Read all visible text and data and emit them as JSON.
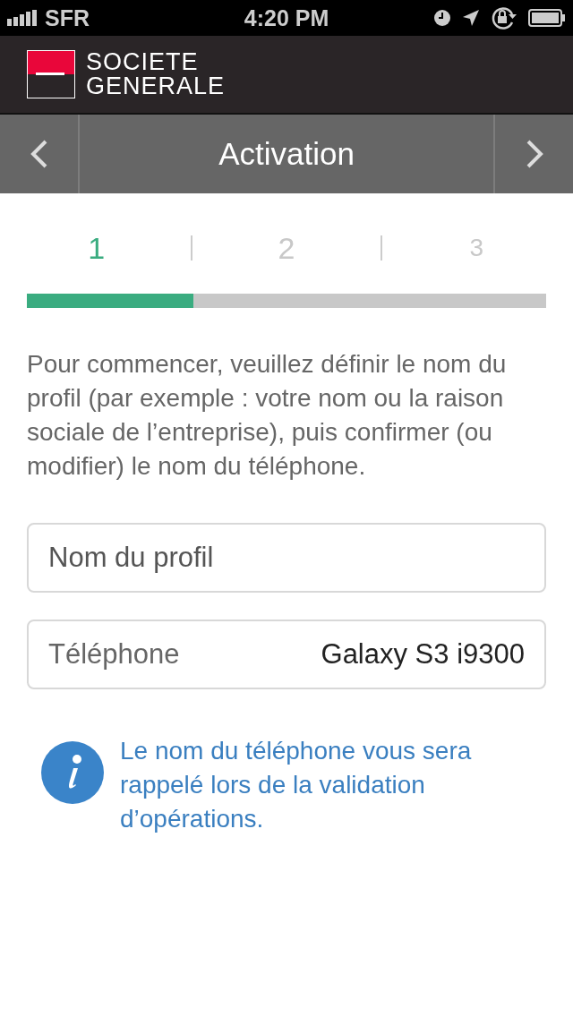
{
  "status_bar": {
    "carrier": "SFR",
    "time": "4:20 PM"
  },
  "brand": {
    "line_1": "SOCIETE",
    "line_2": "GENERALE"
  },
  "nav_bar": {
    "title": "Activation"
  },
  "steps": [
    {
      "label": "1",
      "selected": true
    },
    {
      "label": "2",
      "selected": false
    },
    {
      "label": "3",
      "selected": false
    }
  ],
  "progress": {
    "level": 0.32
  },
  "intro": "Pour commencer, veuillez définir le nom du profil (par exemple : votre nom ou la raison sociale de l’entreprise), puis confirmer (ou modifier) le nom du téléphone.",
  "profile_field": {
    "placeholder": "Nom du profil"
  },
  "phone_field": {
    "label": "Téléphone",
    "value": "Galaxy S3 i9300"
  },
  "info": "Le nom du téléphone vous sera rappelé lors de la validation d’opérations."
}
